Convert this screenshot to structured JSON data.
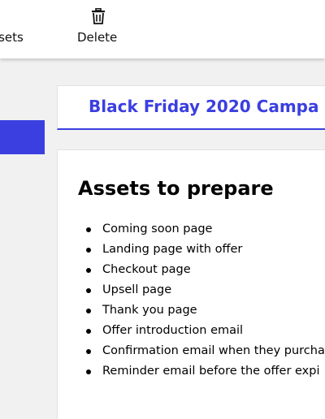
{
  "toolbar": {
    "assets_label": "Assets",
    "delete_label": "Delete",
    "delete_icon": "trash-icon"
  },
  "page": {
    "title": "Black Friday 2020 Campa"
  },
  "content": {
    "heading": "Assets to prepare",
    "items": [
      "Coming soon page",
      "Landing page with offer",
      "Checkout page",
      "Upsell page",
      "Thank you page",
      "Offer introduction email",
      "Confirmation email when they purcha",
      "Reminder email before the offer expi"
    ]
  },
  "colors": {
    "accent": "#3b3fe0",
    "background": "#f1f1f1"
  }
}
